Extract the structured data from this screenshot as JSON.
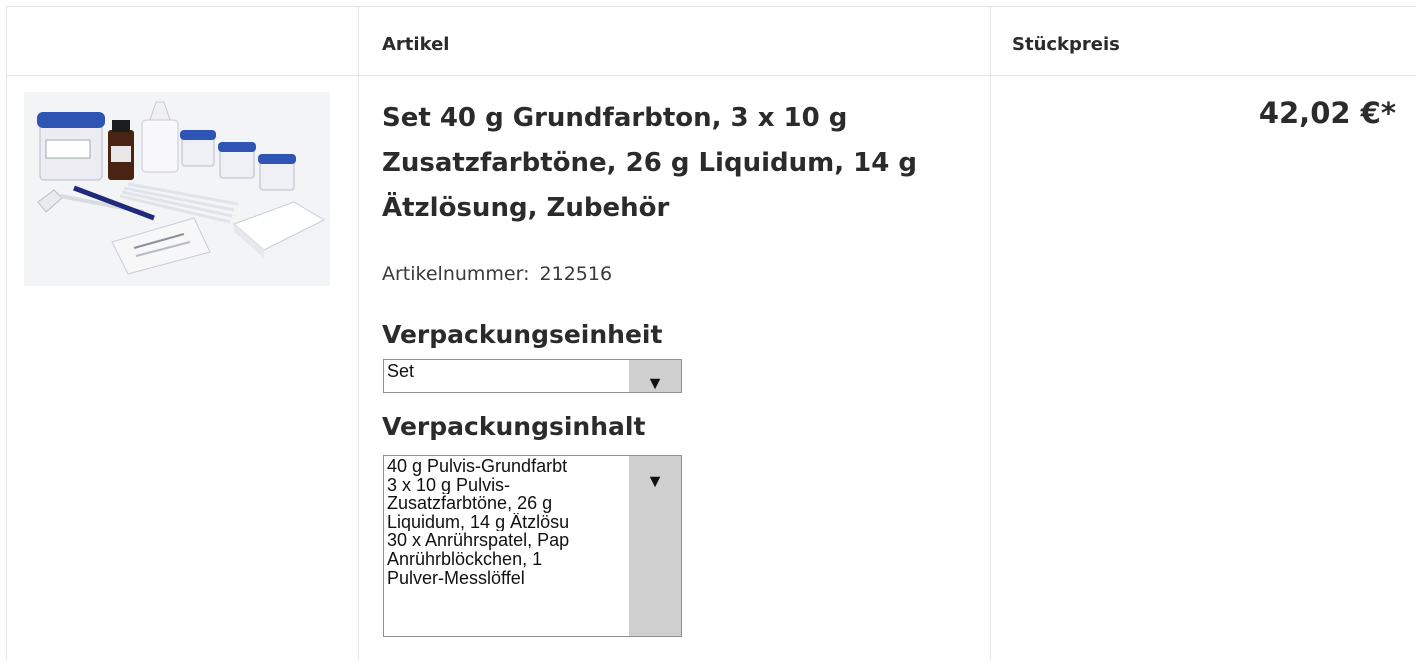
{
  "table": {
    "headers": {
      "article": "Artikel",
      "unit_price": "Stückpreis"
    }
  },
  "item": {
    "image_alt": "Produktbild Set",
    "title": "Set 40 g Grundfarbton, 3 x 10 g Zusatzfarbtöne, 26 g Liquidum, 14 g Ätzlösung, Zubehör",
    "sku_label": "Artikelnummer:",
    "sku": "212516",
    "packaging_unit": {
      "heading": "Verpackungseinheit",
      "selected": "Set"
    },
    "packaging_content": {
      "heading": "Verpackungsinhalt",
      "selected_lines": [
        "40 g Pulvis-Grundfarbt",
        "3 x 10 g Pulvis-",
        "Zusatzfarbtöne, 26 g",
        "Liquidum, 14 g Ätzlösu",
        "30 x Anrührspatel, Pap",
        "Anrührblöckchen, 1",
        "Pulver-Messlöffel"
      ]
    },
    "price": "42,02 €*"
  },
  "icons": {
    "dropdown": "triangle-down"
  },
  "colors": {
    "border": "#e4e4e4",
    "select_arrow_bg": "#cfcfcf",
    "text": "#2b2b2b"
  }
}
